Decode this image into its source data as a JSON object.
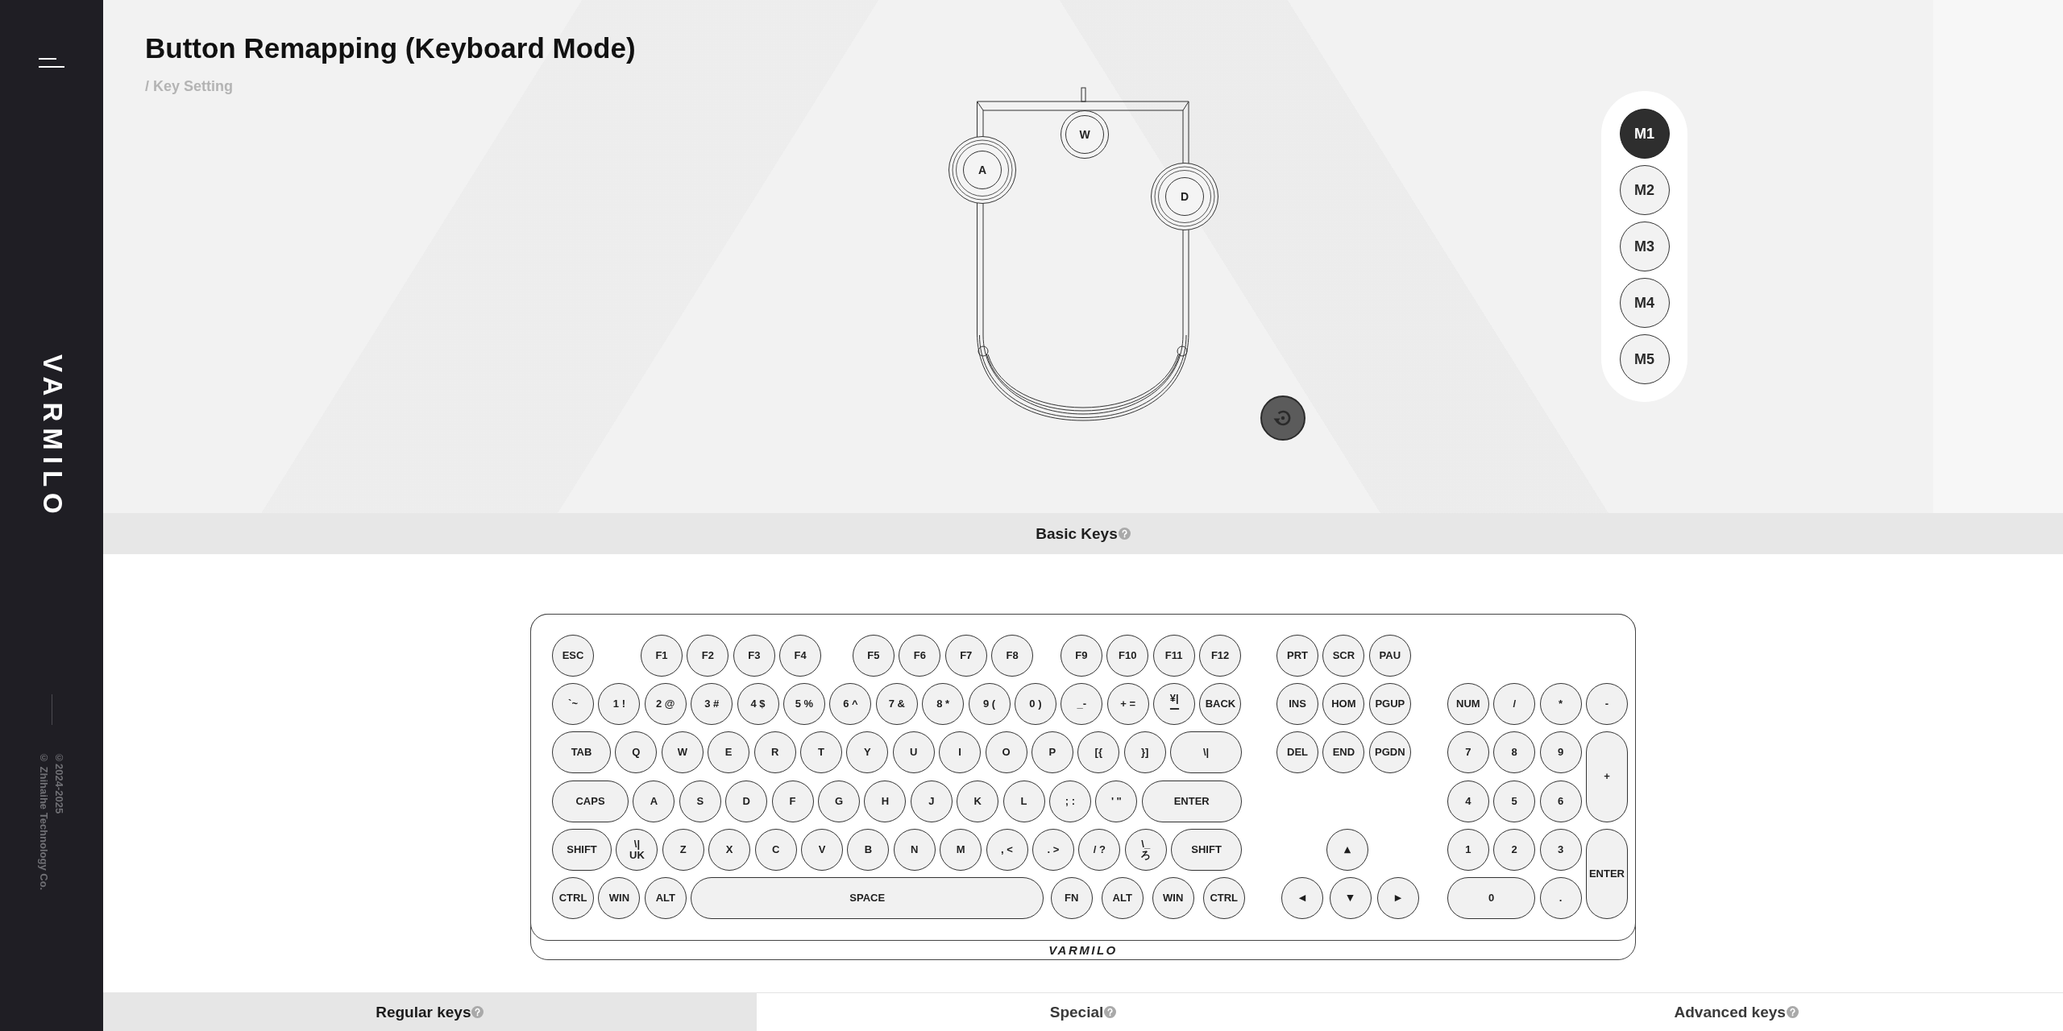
{
  "sidebar": {
    "logo": "VARMILO",
    "copyright": [
      "©2024-2025",
      "© Zhihaihe Technology Co."
    ]
  },
  "header": {
    "title": "Button Remapping (Keyboard Mode)",
    "breadcrumb": "/ Key Setting"
  },
  "device": {
    "keys": [
      "W",
      "A",
      "D"
    ]
  },
  "profiles": [
    {
      "label": "M1",
      "selected": true
    },
    {
      "label": "M2",
      "selected": false
    },
    {
      "label": "M3",
      "selected": false
    },
    {
      "label": "M4",
      "selected": false
    },
    {
      "label": "M5",
      "selected": false
    }
  ],
  "section_bar": {
    "title": "Basic Keys"
  },
  "keyboard": {
    "main_rows": [
      [
        "ESC",
        "F1",
        "F2",
        "F3",
        "F4",
        "F5",
        "F6",
        "F7",
        "F8",
        "F9",
        "F10",
        "F11",
        "F12"
      ],
      [
        "`~",
        "1 !",
        "2 @",
        "3 #",
        "4 $",
        "5 %",
        "6 ^",
        "7 &",
        "8 *",
        "9 (",
        "0 )",
        "_-",
        "+ =",
        "¥|\nー",
        "BACK"
      ],
      [
        "TAB",
        "Q",
        "W",
        "E",
        "R",
        "T",
        "Y",
        "U",
        "I",
        "O",
        "P",
        "[{",
        "}]",
        "\\|"
      ],
      [
        "CAPS",
        "A",
        "S",
        "D",
        "F",
        "G",
        "H",
        "J",
        "K",
        "L",
        "; :",
        "' \"",
        "ENTER"
      ],
      [
        "SHIFT",
        "\\|\nUK",
        "Z",
        "X",
        "C",
        "V",
        "B",
        "N",
        "M",
        ", <",
        ". >",
        "/ ?",
        "\\_\nろ",
        "SHIFT"
      ],
      [
        "CTRL",
        "WIN",
        "ALT",
        "SPACE",
        "FN",
        "ALT",
        "WIN",
        "CTRL"
      ]
    ],
    "nav_rows": [
      [
        "PRT",
        "SCR",
        "PAU"
      ],
      [
        "INS",
        "HOM",
        "PGUP"
      ],
      [
        "DEL",
        "END",
        "PGDN"
      ]
    ],
    "arrow_rows": [
      [
        "▲"
      ],
      [
        "◀",
        "▼",
        "▶"
      ]
    ],
    "numpad_rows": [
      [
        "NUM",
        "/",
        "*",
        "-"
      ],
      [
        "7",
        "8",
        "9",
        "+"
      ],
      [
        "4",
        "5",
        "6"
      ],
      [
        "1",
        "2",
        "3",
        "ENTER"
      ],
      [
        "0",
        "."
      ]
    ],
    "logo": "VARMILO"
  },
  "tabs": [
    {
      "label": "Regular keys",
      "selected": true
    },
    {
      "label": "Special",
      "selected": false
    },
    {
      "label": "Advanced keys",
      "selected": false
    }
  ]
}
